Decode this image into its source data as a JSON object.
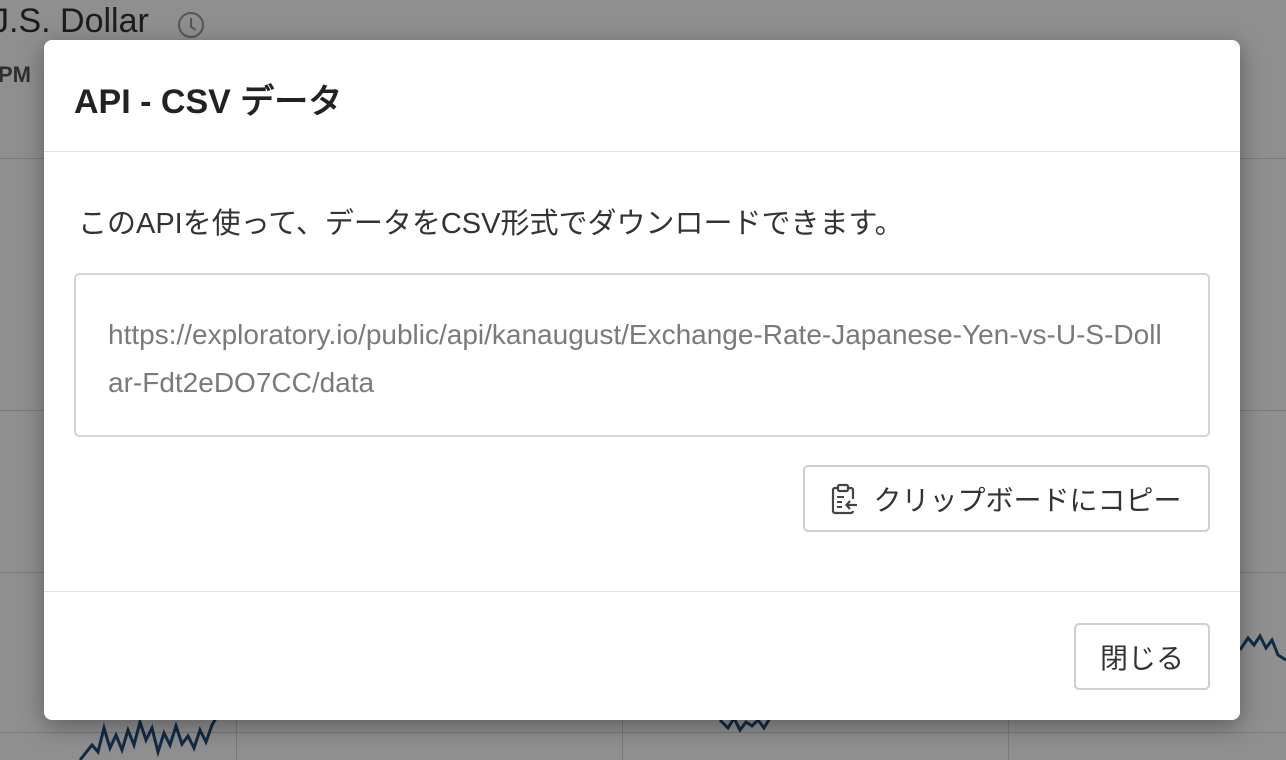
{
  "background": {
    "page_title": "J.S. Dollar",
    "page_subtitle": "PM"
  },
  "modal": {
    "title": "API - CSV データ",
    "description": "このAPIを使って、データをCSV形式でダウンロードできます。",
    "api_url": "https://exploratory.io/public/api/kanaugust/Exchange-Rate-Japanese-Yen-vs-U-S-Dollar-Fdt2eDO7CC/data",
    "copy_button_label": "クリップボードにコピー",
    "copy_button_icon": "clipboard-icon",
    "close_button_label": "閉じる"
  },
  "colors": {
    "chart_line": "#1f4e79",
    "overlay": "rgba(0,0,0,0.44)"
  }
}
